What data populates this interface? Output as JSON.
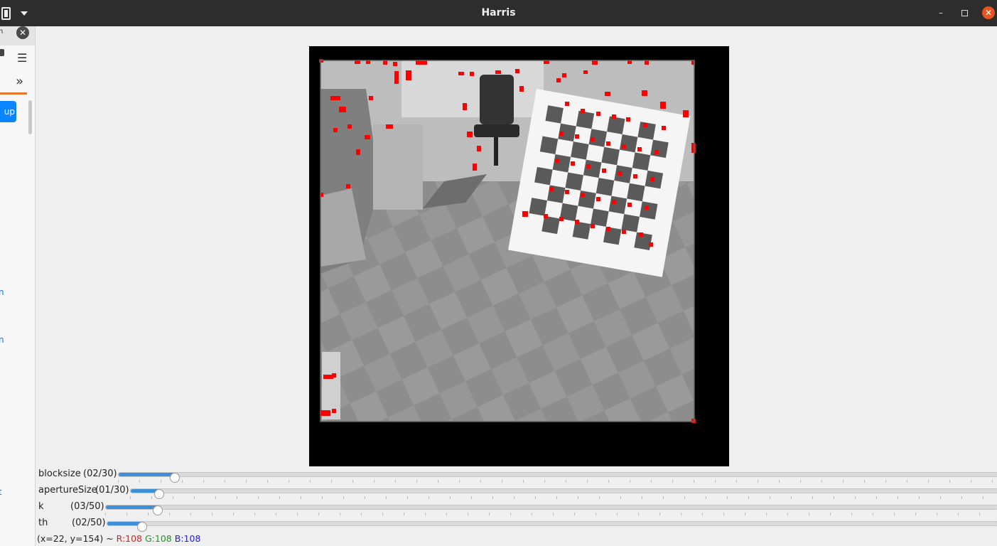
{
  "window": {
    "title": "Harris",
    "minimize_label": "–",
    "close_label": "✕"
  },
  "sidebar": {
    "button_fragment": "up",
    "link_fragments": [
      "n",
      "n",
      "t"
    ]
  },
  "trackbars": [
    {
      "label": "blocksize",
      "value_text": "(02/30)",
      "value": 2,
      "max": 30
    },
    {
      "label": "apertureSize",
      "value_text": "(01/30)",
      "value": 1,
      "max": 30
    },
    {
      "label": "k",
      "value_text": "(03/50)",
      "value": 3,
      "max": 50
    },
    {
      "label": "th",
      "value_text": "(02/50)",
      "value": 2,
      "max": 50
    }
  ],
  "status": {
    "coords": "(x=22, y=154) ~",
    "r": "R:108",
    "g": "G:108",
    "b": "B:108"
  },
  "colors": {
    "corner_marker": "#ff0000",
    "slider_fill": "#3d8fd8",
    "close_button": "#e95420"
  },
  "icons": {
    "battery": "battery-icon",
    "menu": "hamburger-icon",
    "expand": "double-chevron-icon",
    "close": "close-icon"
  }
}
